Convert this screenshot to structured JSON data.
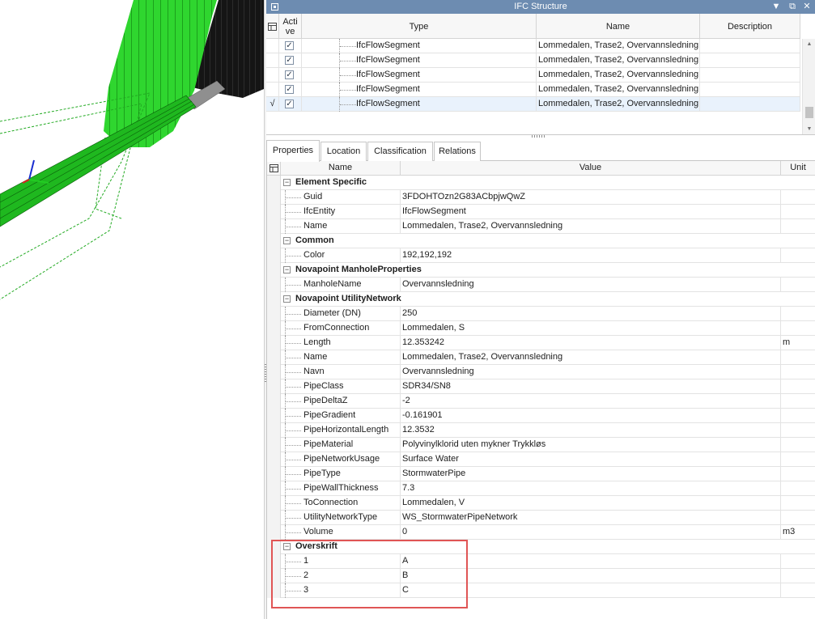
{
  "viewport": {
    "colors": {
      "pipe_green": "#33cc33",
      "pipe_dark": "#111111",
      "pipe_grey": "#8a8a8a",
      "wire": "#22aa22"
    }
  },
  "panel": {
    "title": "IFC Structure",
    "icons": {
      "sys": "window-menu-icon",
      "pin": "dropdown-arrow-icon",
      "float": "float-icon",
      "close": "close-icon"
    },
    "titlebar_color": "#6d8cb1"
  },
  "structure": {
    "columns": {
      "active": "Acti\nve",
      "type": "Type",
      "name": "Name",
      "description": "Description"
    },
    "rows": [
      {
        "type": "IfcFlowSegment",
        "name": "Lommedalen, Trase2, Overvannsledning",
        "description": "",
        "active": true,
        "marker": ""
      },
      {
        "type": "IfcFlowSegment",
        "name": "Lommedalen, Trase2, Overvannsledning",
        "description": "",
        "active": true,
        "marker": ""
      },
      {
        "type": "IfcFlowSegment",
        "name": "Lommedalen, Trase2, Overvannsledning",
        "description": "",
        "active": true,
        "marker": ""
      },
      {
        "type": "IfcFlowSegment",
        "name": "Lommedalen, Trase2, Overvannsledning",
        "description": "",
        "active": true,
        "marker": ""
      },
      {
        "type": "IfcFlowSegment",
        "name": "Lommedalen, Trase2, Overvannsledning",
        "description": "",
        "active": true,
        "marker": "√"
      }
    ]
  },
  "tabs": [
    "Properties",
    "Location",
    "Classification",
    "Relations"
  ],
  "properties": {
    "columns": {
      "name": "Name",
      "value": "Value",
      "unit": "Unit"
    },
    "groups": [
      {
        "name": "Element Specific",
        "items": [
          {
            "name": "Guid",
            "value": "3FDOHTOzn2G83ACbpjwQwZ",
            "unit": ""
          },
          {
            "name": "IfcEntity",
            "value": "IfcFlowSegment",
            "unit": ""
          },
          {
            "name": "Name",
            "value": "Lommedalen, Trase2, Overvannsledning",
            "unit": ""
          }
        ]
      },
      {
        "name": "Common",
        "items": [
          {
            "name": "Color",
            "value": "192,192,192",
            "unit": ""
          }
        ]
      },
      {
        "name": "Novapoint ManholeProperties",
        "items": [
          {
            "name": "ManholeName",
            "value": "Overvannsledning",
            "unit": ""
          }
        ]
      },
      {
        "name": "Novapoint UtilityNetwork",
        "items": [
          {
            "name": "Diameter (DN)",
            "value": "250",
            "unit": ""
          },
          {
            "name": "FromConnection",
            "value": "Lommedalen, S",
            "unit": ""
          },
          {
            "name": "Length",
            "value": "12.353242",
            "unit": "m"
          },
          {
            "name": "Name",
            "value": "Lommedalen, Trase2, Overvannsledning",
            "unit": ""
          },
          {
            "name": "Navn",
            "value": "Overvannsledning",
            "unit": ""
          },
          {
            "name": "PipeClass",
            "value": "SDR34/SN8",
            "unit": ""
          },
          {
            "name": "PipeDeltaZ",
            "value": "-2",
            "unit": ""
          },
          {
            "name": "PipeGradient",
            "value": "-0.161901",
            "unit": ""
          },
          {
            "name": "PipeHorizontalLength",
            "value": "12.3532",
            "unit": ""
          },
          {
            "name": "PipeMaterial",
            "value": "Polyvinylklorid uten mykner Trykkløs",
            "unit": ""
          },
          {
            "name": "PipeNetworkUsage",
            "value": "Surface Water",
            "unit": ""
          },
          {
            "name": "PipeType",
            "value": "StormwaterPipe",
            "unit": ""
          },
          {
            "name": "PipeWallThickness",
            "value": "7.3",
            "unit": ""
          },
          {
            "name": "ToConnection",
            "value": "Lommedalen, V",
            "unit": ""
          },
          {
            "name": "UtilityNetworkType",
            "value": "WS_StormwaterPipeNetwork",
            "unit": ""
          },
          {
            "name": "Volume",
            "value": "0",
            "unit": "m3"
          }
        ]
      },
      {
        "name": "Overskrift",
        "items": [
          {
            "name": "1",
            "value": "A",
            "unit": ""
          },
          {
            "name": "2",
            "value": "B",
            "unit": ""
          },
          {
            "name": "3",
            "value": "C",
            "unit": ""
          }
        ]
      }
    ]
  },
  "highlight_color": "#e05555"
}
